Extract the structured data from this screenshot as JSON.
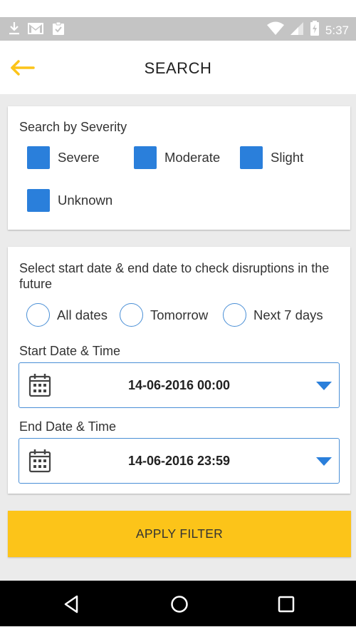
{
  "status_bar": {
    "time": "5:37",
    "icons": [
      "download-icon",
      "gmail-icon",
      "clipboard-check-icon",
      "wifi-icon",
      "signal-icon",
      "battery-charging-icon"
    ]
  },
  "app_bar": {
    "title": "SEARCH",
    "back_icon": "arrow-left-icon",
    "accent_color": "#fcc419"
  },
  "severity": {
    "heading": "Search by Severity",
    "options": [
      {
        "label": "Severe",
        "checked": true
      },
      {
        "label": "Moderate",
        "checked": true
      },
      {
        "label": "Slight",
        "checked": true
      },
      {
        "label": "Unknown",
        "checked": true
      }
    ],
    "checkbox_color": "#2a7fdb"
  },
  "dates": {
    "heading": "Select start date & end date to check disruptions in the future",
    "range_options": [
      {
        "label": "All dates",
        "selected": false
      },
      {
        "label": "Tomorrow",
        "selected": false
      },
      {
        "label": "Next 7 days",
        "selected": false
      }
    ],
    "start": {
      "label": "Start Date & Time",
      "value": "14-06-2016 00:00"
    },
    "end": {
      "label": "End Date & Time",
      "value": "14-06-2016 23:59"
    },
    "field_border_color": "#4a8fd6"
  },
  "apply_button": {
    "label": "APPLY FILTER",
    "color": "#fcc419"
  },
  "nav_bar": {
    "icons": [
      "back-triangle-icon",
      "home-circle-icon",
      "recents-square-icon"
    ]
  }
}
